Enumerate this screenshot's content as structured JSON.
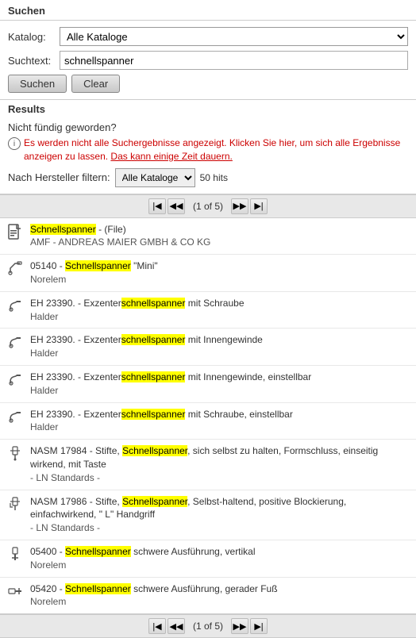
{
  "section": {
    "title": "Suchen"
  },
  "form": {
    "katalog_label": "Katalog:",
    "katalog_value": "Alle Kataloge",
    "katalog_options": [
      "Alle Kataloge"
    ],
    "suchtext_label": "Suchtext:",
    "suchtext_value": "schnellspanner",
    "search_button": "Suchen",
    "clear_button": "Clear"
  },
  "results": {
    "header": "Results",
    "not_found": "Nicht fündig geworden?",
    "warning_text": "Es werden nicht alle Suchergebnisse angezeigt. Klicken Sie hier, um sich alle Ergebnisse anzeigen zu lassen.",
    "warning_text2": "Das kann einige Zeit dauern.",
    "filter_label": "Nach Hersteller filtern:",
    "filter_value": "Alle Kataloge",
    "filter_options": [
      "Alle Kataloge"
    ],
    "hits": "50 hits",
    "pagination": {
      "page_info": "(1 of 5)"
    },
    "items": [
      {
        "icon": "📄",
        "icon_name": "file-icon",
        "title_parts": [
          "Schnellspanner",
          " - (File)"
        ],
        "sub": "AMF - ANDREAS MAIER GMBH & CO KG",
        "highlight": "Schnellspanner"
      },
      {
        "icon": "🔧",
        "icon_name": "tool-icon",
        "title_parts": [
          "05140 - ",
          "Schnellspanner",
          " \"Mini\""
        ],
        "sub": "Norelem",
        "highlight": "Schnellspanner"
      },
      {
        "icon": "🔩",
        "icon_name": "part-icon",
        "title_parts": [
          "EH 23390. - Exzenter",
          "schnellspanner",
          " mit Schraube"
        ],
        "sub": "Halder",
        "highlight": "schnellspanner"
      },
      {
        "icon": "🔩",
        "icon_name": "part-icon2",
        "title_parts": [
          "EH 23390. - Exzenter",
          "schnellspanner",
          " mit Innengewinde"
        ],
        "sub": "Halder",
        "highlight": "schnellspanner"
      },
      {
        "icon": "🔩",
        "icon_name": "part-icon3",
        "title_parts": [
          "EH 23390. - Exzenter",
          "schnellspanner",
          " mit Innengewinde, einstellbar"
        ],
        "sub": "Halder",
        "highlight": "schnellspanner"
      },
      {
        "icon": "🔩",
        "icon_name": "part-icon4",
        "title_parts": [
          "EH 23390. - Exzenter",
          "schnellspanner",
          " mit Schraube, einstellbar"
        ],
        "sub": "Halder",
        "highlight": "schnellspanner"
      },
      {
        "icon": "🔧",
        "icon_name": "tool-icon2",
        "title_parts": [
          "NASM 17984 - Stifte, ",
          "Schnellspanner",
          ", sich selbst zu halten, Formschluss, einseitig wirkend, mit Taste"
        ],
        "sub": "- LN Standards -",
        "highlight": "Schnellspanner"
      },
      {
        "icon": "🔧",
        "icon_name": "tool-icon3",
        "title_parts": [
          "NASM 17986 - Stifte, ",
          "Schnellspanner",
          ", Selbst-haltend, positive Blockierung, einfachwirkend, \" L\" Handgriff"
        ],
        "sub": "- LN Standards -",
        "highlight": "Schnellspanner"
      },
      {
        "icon": "🔩",
        "icon_name": "part-icon5",
        "title_parts": [
          "05400 - ",
          "Schnellspanner",
          " schwere Ausführung, vertikal"
        ],
        "sub": "Norelem",
        "highlight": "Schnellspanner"
      },
      {
        "icon": "🔩",
        "icon_name": "part-icon6",
        "title_parts": [
          "05420 - ",
          "Schnellspanner",
          " schwere Ausführung, gerader Fuß"
        ],
        "sub": "Norelem",
        "highlight": "Schnellspanner"
      }
    ]
  }
}
